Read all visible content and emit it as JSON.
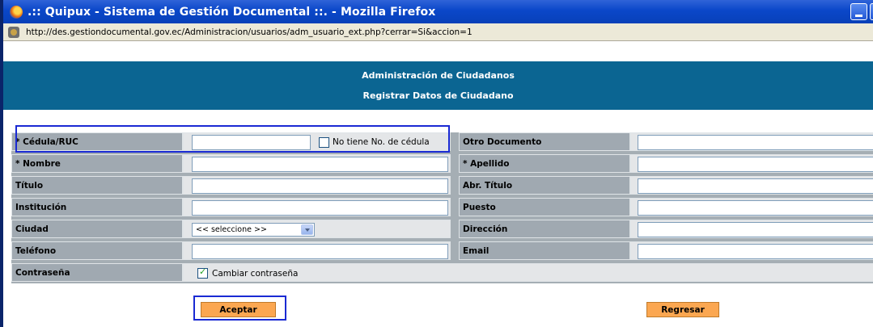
{
  "window": {
    "title": ".:: Quipux - Sistema de Gestión Documental ::. - Mozilla Firefox",
    "url": "http://des.gestiondocumental.gov.ec/Administracion/usuarios/adm_usuario_ext.php?cerrar=Si&accion=1"
  },
  "header": {
    "line1": "Administración de Ciudadanos",
    "line2": "Registrar Datos de Ciudadano"
  },
  "form": {
    "cedula_label": "* Cédula/RUC",
    "cedula_value": "",
    "no_cedula_label": "No tiene No. de cédula",
    "no_cedula_checked": false,
    "otro_documento_label": "Otro Documento",
    "nombre_label": "* Nombre",
    "apellido_label": "* Apellido",
    "titulo_label": "Título",
    "abr_titulo_label": "Abr. Título",
    "institucion_label": "Institución",
    "puesto_label": "Puesto",
    "ciudad_label": "Ciudad",
    "ciudad_selected": "<< seleccione >>",
    "direccion_label": "Dirección",
    "telefono_label": "Teléfono",
    "email_label": "Email",
    "contrasena_label": "Contraseña",
    "cambiar_contrasena_label": "Cambiar contraseña",
    "cambiar_contrasena_checked": true
  },
  "buttons": {
    "accept": "Aceptar",
    "back": "Regresar"
  },
  "colors": {
    "header_bg": "#0b6592",
    "button_bg": "#fba751",
    "highlight": "#1a2ad3"
  }
}
